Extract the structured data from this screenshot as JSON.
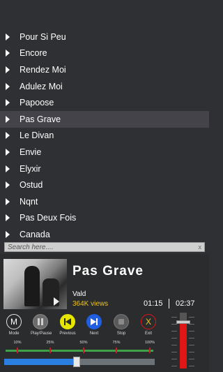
{
  "playlist": {
    "tracks": [
      {
        "title": "Pour Si Peu"
      },
      {
        "title": "Encore"
      },
      {
        "title": "Rendez Moi"
      },
      {
        "title": "Adulez Moi"
      },
      {
        "title": "Papoose"
      },
      {
        "title": "Pas Grave",
        "selected": true
      },
      {
        "title": "Le Divan"
      },
      {
        "title": "Envie"
      },
      {
        "title": "Elyxir"
      },
      {
        "title": "Ostud"
      },
      {
        "title": "Nqnt"
      },
      {
        "title": "Pas Deux Fois"
      },
      {
        "title": "Canada"
      }
    ]
  },
  "search": {
    "placeholder": "Search here....",
    "clear_glyph": "x"
  },
  "now_playing": {
    "title": "Pas Grave",
    "artist": "Vald",
    "views": "364K views",
    "current_time": "01:15",
    "duration": "02:37",
    "progress": 0.48
  },
  "controls": [
    {
      "name": "mode-button",
      "label": "Mode",
      "glyph": "M",
      "icon": "mode-icon",
      "border": "#e6e6e6",
      "fill": "transparent",
      "color": "#ffffff"
    },
    {
      "name": "play-pause-button",
      "label": "Play/Pause",
      "glyph": "pause",
      "icon": "pause-icon",
      "border": "#8a8a8a",
      "fill": "#6b6b6b",
      "color": "#cfcfcf"
    },
    {
      "name": "previous-button",
      "label": "Previous",
      "glyph": "prev",
      "icon": "previous-icon",
      "border": "#e6e600",
      "fill": "#e6e600",
      "color": "#2a2c2e"
    },
    {
      "name": "next-button",
      "label": "Next",
      "glyph": "next",
      "icon": "next-icon",
      "border": "#1f5fe0",
      "fill": "#1f5fe0",
      "color": "#ffffff"
    },
    {
      "name": "stop-button",
      "label": "Stop",
      "glyph": "stop",
      "icon": "stop-icon",
      "border": "#7a7a7a",
      "fill": "#5a5a5a",
      "color": "#8a8a8a"
    },
    {
      "name": "exit-button",
      "label": "Exit",
      "glyph": "X",
      "icon": "exit-icon",
      "border": "#e01616",
      "fill": "transparent",
      "color": "#f0c419"
    }
  ],
  "equalizer": {
    "labels": [
      "10%",
      "25%",
      "50%",
      "75%",
      "100%"
    ]
  },
  "volume": {
    "level": 0.82
  },
  "colors": {
    "background": "#2e3033",
    "selected_row": "#45434a",
    "views": "#f0c419",
    "seek_fill": "#2b7fe0",
    "volume_fill": "#e01616",
    "eq_track": "#3fa24a"
  }
}
